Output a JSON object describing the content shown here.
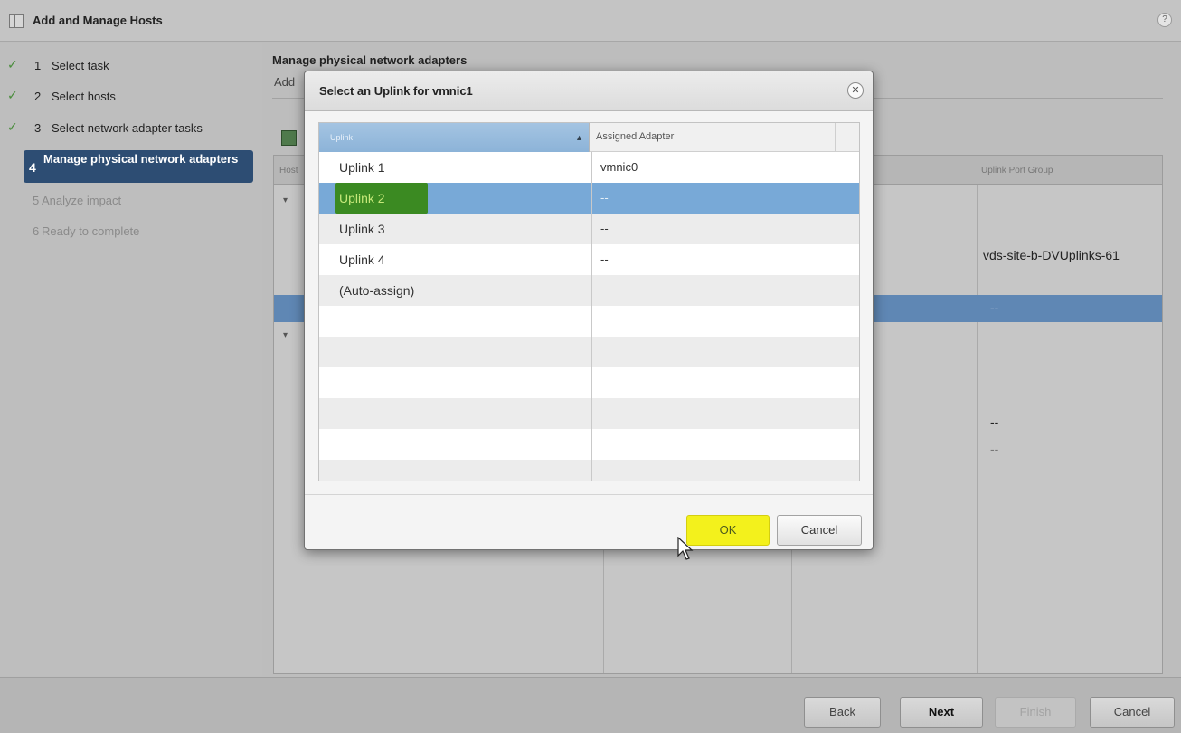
{
  "window": {
    "title": "Add and Manage Hosts",
    "help_icon": "help-icon",
    "help_glyph": "?"
  },
  "steps": [
    {
      "num": "1",
      "label": "Select task",
      "state": "done"
    },
    {
      "num": "2",
      "label": "Select hosts",
      "state": "done"
    },
    {
      "num": "3",
      "label": "Select network adapter tasks",
      "state": "done"
    },
    {
      "num": "4",
      "label": "Manage physical network adapters",
      "state": "active"
    },
    {
      "num": "5",
      "label": "Analyze impact",
      "state": "disabled"
    },
    {
      "num": "6",
      "label": "Ready to complete",
      "state": "disabled"
    }
  ],
  "check_glyph": "✓",
  "main": {
    "heading": "Manage physical network adapters",
    "subheading": "Add",
    "grid": {
      "header_host": "Host",
      "header_uplink_port_group": "Uplink Port Group",
      "cell_port_group": "vds-site-b-DVUplinks-61",
      "cell_dash_selected": "--",
      "cell_dash_1": "--",
      "cell_dash_2": "--",
      "expander_glyph": "▾"
    }
  },
  "dialog": {
    "title": "Select an Uplink for vmnic1",
    "close_glyph": "✕",
    "columns": {
      "uplink": "Uplink",
      "assigned_adapter": "Assigned Adapter",
      "sort_glyph": "▲"
    },
    "rows": [
      {
        "uplink": "Uplink 1",
        "adapter": "vmnic0"
      },
      {
        "uplink": "Uplink 2",
        "adapter": "--"
      },
      {
        "uplink": "Uplink 3",
        "adapter": "--"
      },
      {
        "uplink": "Uplink 4",
        "adapter": "--"
      },
      {
        "uplink": "(Auto-assign)",
        "adapter": ""
      }
    ],
    "selected_row": 1,
    "ok_label": "OK",
    "cancel_label": "Cancel"
  },
  "buttons": {
    "back": "Back",
    "next": "Next",
    "finish": "Finish",
    "cancel": "Cancel"
  },
  "colors": {
    "active_step": "#2d4d73",
    "selection": "#78a9d7",
    "highlight_yellow": "#f3f11c",
    "highlight_green": "#3b8a22",
    "check_green": "#4a8d3c"
  }
}
